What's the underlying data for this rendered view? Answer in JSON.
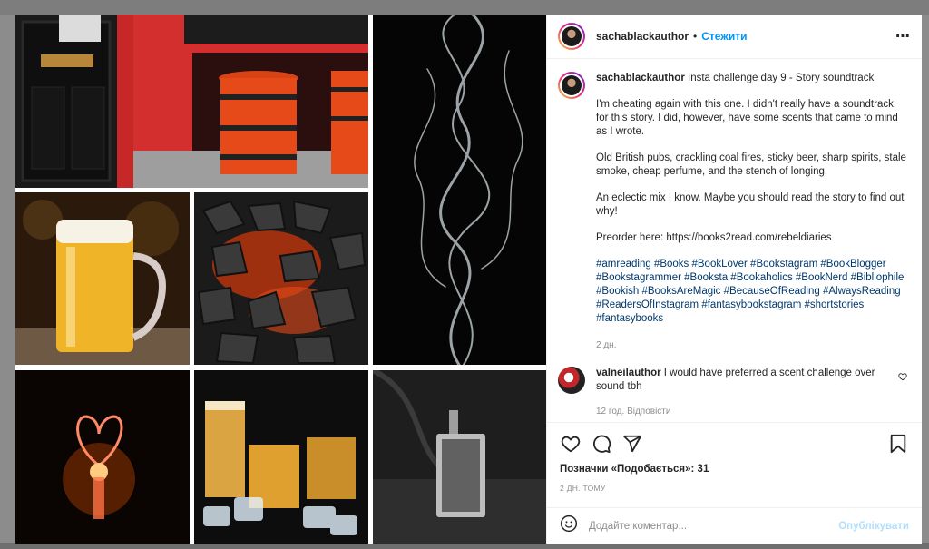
{
  "header": {
    "username": "sachablackauthor",
    "separator": "•",
    "follow_label": "Стежити",
    "more_label": "⋯"
  },
  "caption": {
    "username": "sachablackauthor",
    "title": "Insta challenge day 9 - Story soundtrack",
    "paragraphs": [
      "I'm cheating again with this one. I didn't really have a soundtrack for this story. I did, however, have some scents that came to mind as I wrote.",
      "Old British pubs, crackling coal fires, sticky beer, sharp spirits, stale smoke, cheap perfume, and the stench of longing.",
      "An eclectic mix I know. Maybe you should read the story to find out why!",
      "Preorder here: https://books2read.com/rebeldiaries"
    ],
    "hashtags": "#amreading #Books #BookLover #Bookstagram #BookBlogger #Bookstagrammer #Booksta #Bookaholics #BookNerd #Bibliophile #Bookish #BooksAreMagic #BecauseOfReading #AlwaysReading #ReadersOfInstagram #fantasybookstagram #shortstories #fantasybooks",
    "age": "2 дн."
  },
  "reply": {
    "username": "valneilauthor",
    "text": "I would have preferred a scent challenge over sound tbh",
    "meta": "12 год.   Відповісти"
  },
  "likes_text": "Позначки «Подобається»: 31",
  "time_text": "2 ДН. ТОМУ",
  "comment_input": {
    "placeholder": "Додайте коментар...",
    "publish_label": "Опублікувати"
  },
  "icons": {
    "like": "heart-icon",
    "comment": "comment-icon",
    "share": "share-icon",
    "save": "bookmark-icon",
    "emoji": "emoji-icon",
    "reply_like": "heart-icon"
  }
}
